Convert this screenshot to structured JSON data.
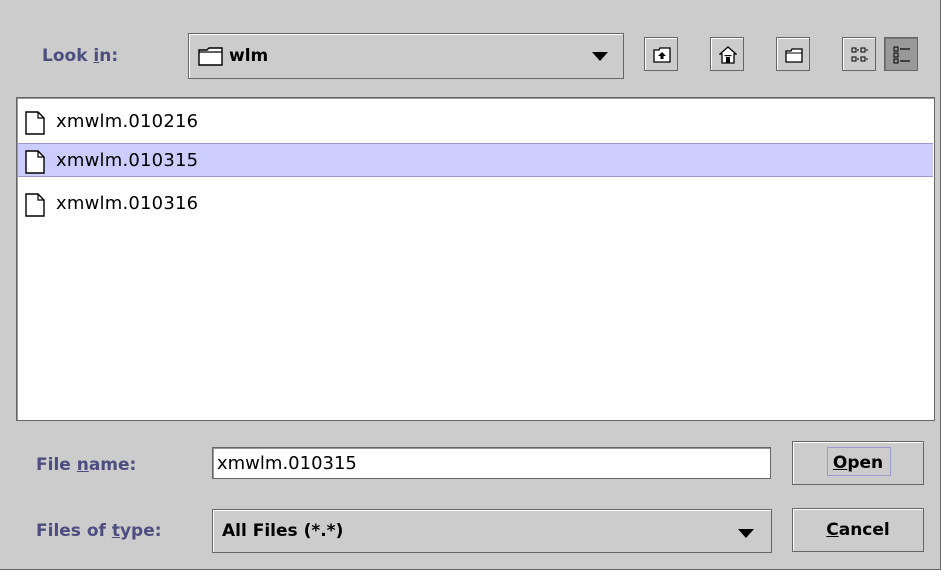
{
  "lookin": {
    "label_pre": "Look ",
    "label_mnemonic": "i",
    "label_post": "n:",
    "selected": "wlm"
  },
  "toolbar": {
    "icons": [
      "up-one-level-icon",
      "home-icon",
      "new-folder-icon",
      "list-view-icon",
      "details-view-icon"
    ]
  },
  "files": [
    {
      "name": "xmwlm.010216",
      "selected": false
    },
    {
      "name": "xmwlm.010315",
      "selected": true
    },
    {
      "name": "xmwlm.010316",
      "selected": false
    }
  ],
  "filename": {
    "label_pre": "File ",
    "label_mnemonic": "n",
    "label_post": "ame:",
    "value": "xmwlm.010315"
  },
  "filetype": {
    "label_pre": "Files of ",
    "label_mnemonic": "t",
    "label_post": "ype:",
    "selected": "All Files (*.*)"
  },
  "buttons": {
    "open_mnemonic": "O",
    "open_rest": "pen",
    "cancel_mnemonic": "C",
    "cancel_rest": "ancel"
  },
  "colors": {
    "panel": "#cccccc",
    "label": "#4d4d80",
    "selection": "#ccccff"
  }
}
